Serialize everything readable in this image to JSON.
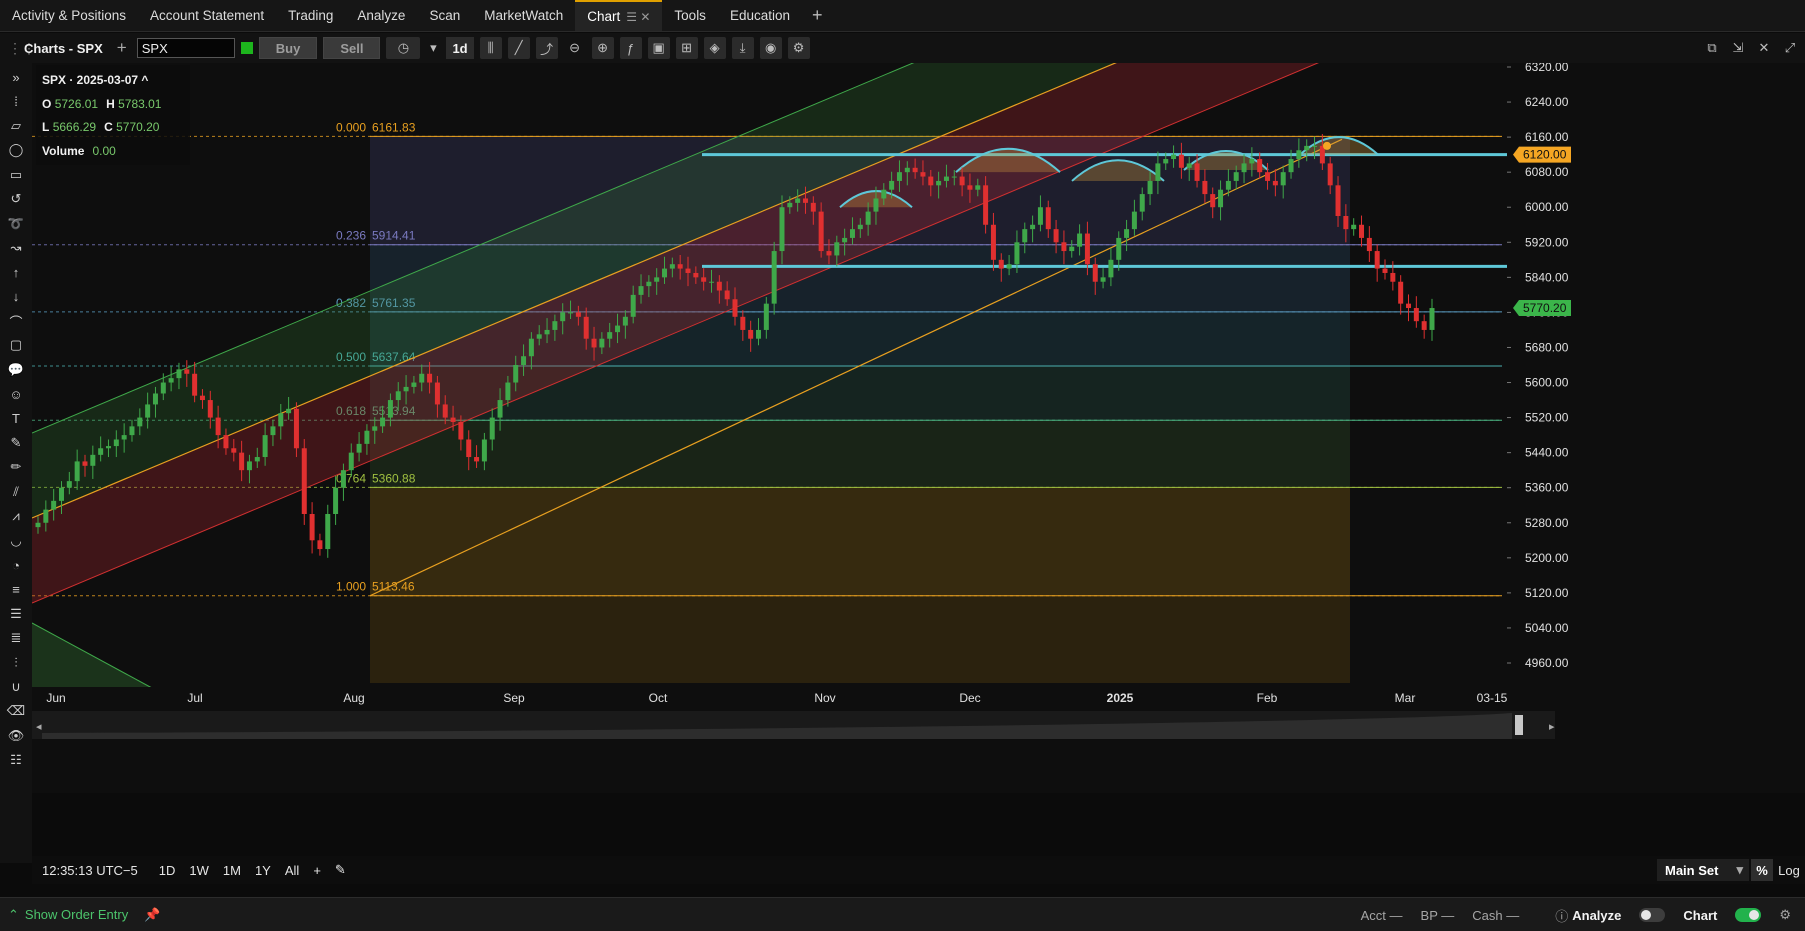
{
  "tabs": [
    {
      "label": "Activity & Positions"
    },
    {
      "label": "Account Statement"
    },
    {
      "label": "Trading"
    },
    {
      "label": "Analyze"
    },
    {
      "label": "Scan"
    },
    {
      "label": "MarketWatch"
    },
    {
      "label": "Chart",
      "active": true
    },
    {
      "label": "Tools"
    },
    {
      "label": "Education"
    }
  ],
  "toolbar": {
    "chart_title": "Charts - SPX",
    "symbol": "SPX",
    "buy_label": "Buy",
    "sell_label": "Sell",
    "interval": "1d"
  },
  "ohlc": {
    "header": "SPX · 2025-03-07 ^",
    "open_label": "O",
    "open": "5726.01",
    "high_label": "H",
    "high": "5783.01",
    "low_label": "L",
    "low": "5666.29",
    "close_label": "C",
    "close": "5770.20",
    "volume_label": "Volume",
    "volume": "0.00"
  },
  "chart_data": {
    "type": "candlestick",
    "symbol": "SPX",
    "y_axis_ticks": [
      6320,
      6240,
      6160,
      6080,
      6000,
      5920,
      5840,
      5760,
      5680,
      5600,
      5520,
      5440,
      5360,
      5280,
      5200,
      5120,
      5040,
      4960
    ],
    "ylim": [
      4890,
      6370
    ],
    "x_axis_labels": [
      "Jun",
      "Jul",
      "Aug",
      "Sep",
      "Oct",
      "Nov",
      "Dec",
      "2025",
      "Feb",
      "Mar",
      "03-15"
    ],
    "price_markers": [
      {
        "value": "6120.00",
        "color": "#f5a623"
      },
      {
        "value": "5770.20",
        "color": "#3bb54a"
      }
    ],
    "fibonacci": [
      {
        "level": "0.000",
        "price": "6161.83"
      },
      {
        "level": "0.236",
        "price": "5914.41"
      },
      {
        "level": "0.382",
        "price": "5761.35"
      },
      {
        "level": "0.500",
        "price": "5637.64"
      },
      {
        "level": "0.618",
        "price": "5513.94"
      },
      {
        "level": "0.764",
        "price": "5360.88"
      },
      {
        "level": "1.000",
        "price": "5113.46"
      }
    ],
    "close_series": [
      5280,
      5310,
      5330,
      5360,
      5375,
      5420,
      5410,
      5435,
      5450,
      5455,
      5470,
      5480,
      5500,
      5520,
      5550,
      5575,
      5600,
      5610,
      5630,
      5620,
      5570,
      5560,
      5520,
      5480,
      5450,
      5440,
      5400,
      5420,
      5430,
      5480,
      5500,
      5530,
      5540,
      5450,
      5300,
      5240,
      5220,
      5300,
      5360,
      5400,
      5440,
      5460,
      5490,
      5500,
      5520,
      5560,
      5580,
      5590,
      5600,
      5620,
      5600,
      5550,
      5520,
      5510,
      5470,
      5430,
      5420,
      5470,
      5520,
      5560,
      5600,
      5640,
      5660,
      5700,
      5710,
      5720,
      5740,
      5760,
      5760,
      5750,
      5700,
      5680,
      5700,
      5715,
      5730,
      5750,
      5800,
      5820,
      5830,
      5840,
      5860,
      5870,
      5860,
      5850,
      5840,
      5830,
      5830,
      5810,
      5790,
      5750,
      5720,
      5700,
      5720,
      5780,
      5900,
      6000,
      6010,
      6020,
      6010,
      5990,
      5900,
      5890,
      5920,
      5930,
      5950,
      5960,
      5990,
      6020,
      6040,
      6060,
      6080,
      6090,
      6080,
      6070,
      6050,
      6060,
      6070,
      6070,
      6050,
      6040,
      6050,
      5960,
      5880,
      5860,
      5870,
      5920,
      5950,
      5960,
      6000,
      5950,
      5920,
      5900,
      5910,
      5940,
      5870,
      5830,
      5840,
      5880,
      5930,
      5950,
      5990,
      6030,
      6060,
      6100,
      6110,
      6120,
      6090,
      6100,
      6060,
      6030,
      6000,
      6040,
      6060,
      6080,
      6100,
      6110,
      6080,
      6060,
      6050,
      6080,
      6110,
      6130,
      6140,
      6140,
      6100,
      6050,
      5980,
      5950,
      5960,
      5930,
      5900,
      5860,
      5850,
      5830,
      5780,
      5770,
      5740,
      5720,
      5770
    ]
  },
  "time_range": {
    "clock": "12:35:13 UTC−5",
    "ranges": [
      "1D",
      "1W",
      "1M",
      "1Y",
      "All"
    ],
    "main_set": "Main Set",
    "pct_label": "%",
    "log_label": "Log"
  },
  "status": {
    "order_entry": "Show Order Entry",
    "acct": "Acct —",
    "bp": "BP —",
    "cash": "Cash —",
    "analyze_label": "Analyze",
    "chart_label": "Chart"
  }
}
